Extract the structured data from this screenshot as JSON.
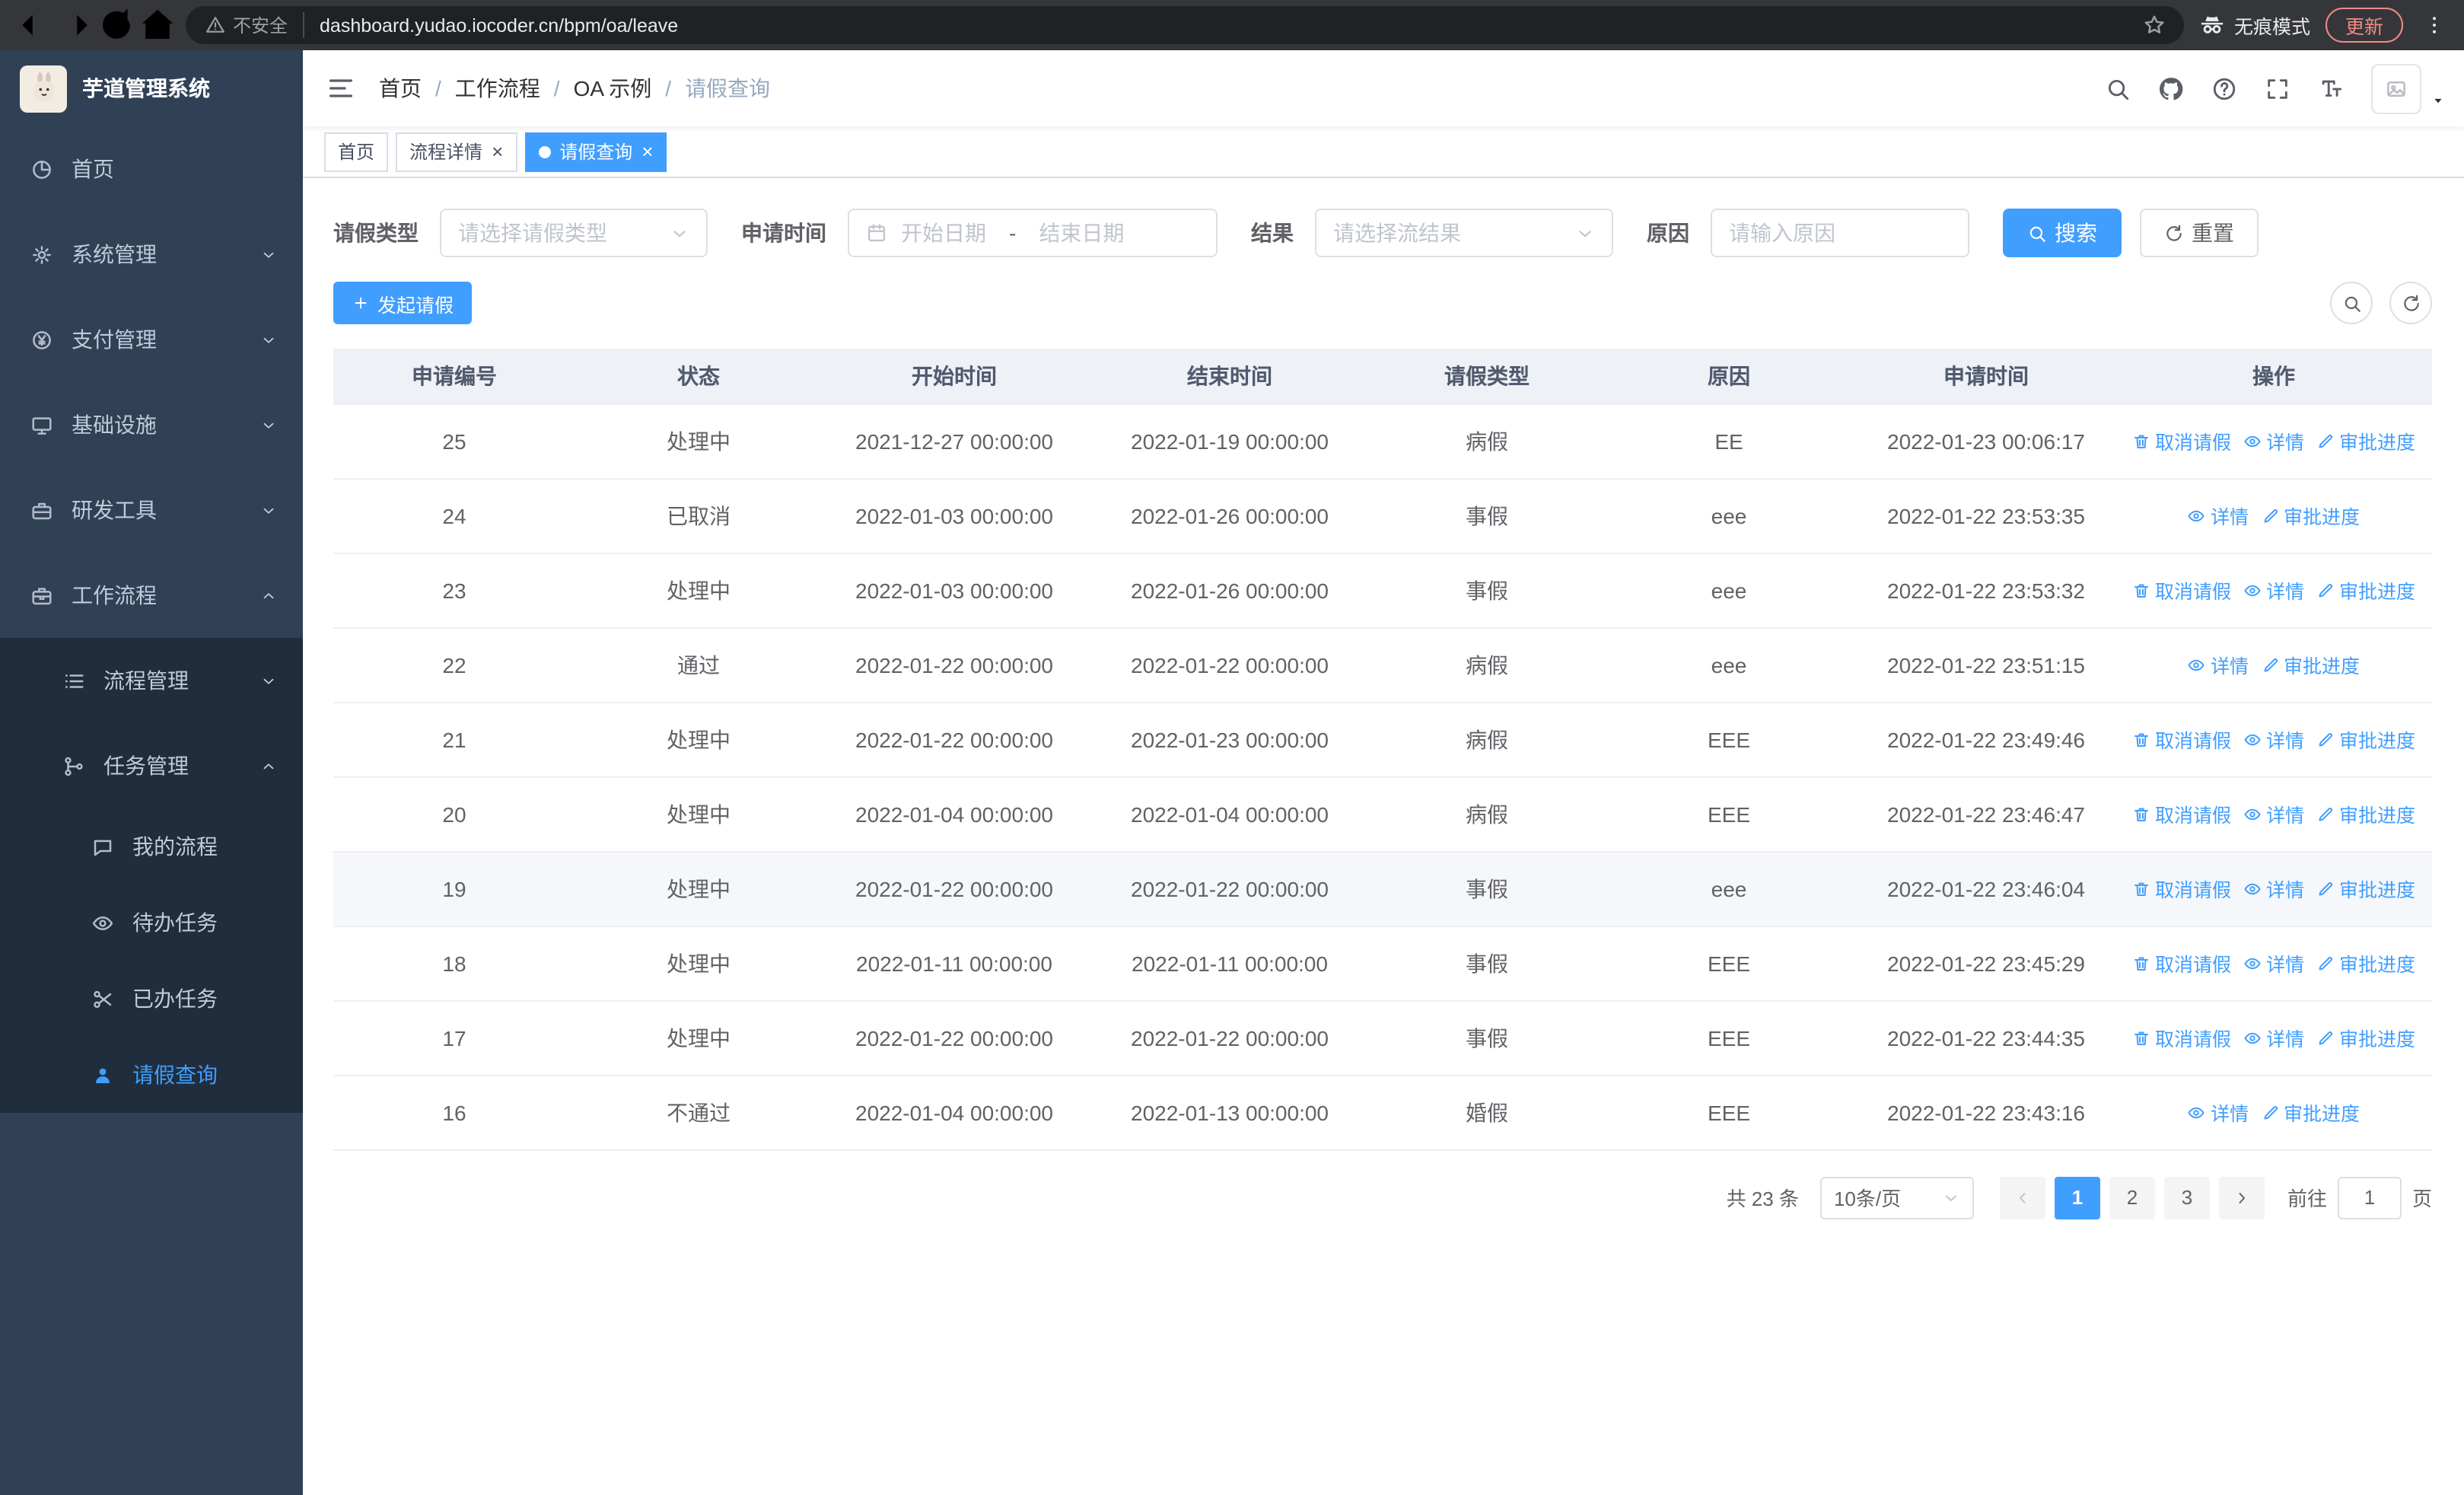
{
  "browser": {
    "security_label": "不安全",
    "url": "dashboard.yudao.iocoder.cn/bpm/oa/leave",
    "incognito_label": "无痕模式",
    "update_label": "更新"
  },
  "sidebar": {
    "logo_title": "芋道管理系统",
    "items": [
      {
        "key": "home",
        "label": "首页",
        "icon": "dashboard-icon",
        "level": 1,
        "arrow": null,
        "active": false
      },
      {
        "key": "system",
        "label": "系统管理",
        "icon": "gear-icon",
        "level": 1,
        "arrow": "down",
        "active": false
      },
      {
        "key": "payment",
        "label": "支付管理",
        "icon": "payment-icon",
        "level": 1,
        "arrow": "down",
        "active": false
      },
      {
        "key": "infrastructure",
        "label": "基础设施",
        "icon": "infrastructure-icon",
        "level": 1,
        "arrow": "down",
        "active": false
      },
      {
        "key": "devtools",
        "label": "研发工具",
        "icon": "tools-icon",
        "level": 1,
        "arrow": "down",
        "active": false
      },
      {
        "key": "workflow",
        "label": "工作流程",
        "icon": "workflow-icon",
        "level": 1,
        "arrow": "up",
        "active": false
      },
      {
        "key": "process-management",
        "label": "流程管理",
        "icon": "process-icon",
        "level": 2,
        "arrow": "down",
        "active": false
      },
      {
        "key": "task-management",
        "label": "任务管理",
        "icon": "task-icon",
        "level": 2,
        "arrow": "up",
        "active": false
      },
      {
        "key": "my-process",
        "label": "我的流程",
        "icon": "my-process-icon",
        "level": 3,
        "arrow": null,
        "active": false
      },
      {
        "key": "todo-task",
        "label": "待办任务",
        "icon": "todo-task-icon",
        "level": 3,
        "arrow": null,
        "active": false
      },
      {
        "key": "done-task",
        "label": "已办任务",
        "icon": "done-task-icon",
        "level": 3,
        "arrow": null,
        "active": false
      },
      {
        "key": "leave-query",
        "label": "请假查询",
        "icon": "leave-query-icon",
        "level": 3,
        "arrow": null,
        "active": true
      }
    ]
  },
  "navbar": {
    "breadcrumb": [
      "首页",
      "工作流程",
      "OA 示例",
      "请假查询"
    ]
  },
  "tabs": [
    {
      "key": "home",
      "label": "首页",
      "closable": false,
      "active": false
    },
    {
      "key": "process-detail",
      "label": "流程详情",
      "closable": true,
      "active": false
    },
    {
      "key": "leave-query",
      "label": "请假查询",
      "closable": true,
      "active": true
    }
  ],
  "filters": {
    "leave_type": {
      "label": "请假类型",
      "placeholder": "请选择请假类型"
    },
    "apply_time": {
      "label": "申请时间",
      "start_placeholder": "开始日期",
      "separator": "-",
      "end_placeholder": "结束日期"
    },
    "result": {
      "label": "结果",
      "placeholder": "请选择流结果"
    },
    "reason": {
      "label": "原因",
      "placeholder": "请输入原因"
    },
    "search_label": "搜索",
    "reset_label": "重置"
  },
  "toolbar": {
    "create_label": "发起请假"
  },
  "table": {
    "columns": [
      "申请编号",
      "状态",
      "开始时间",
      "结束时间",
      "请假类型",
      "原因",
      "申请时间",
      "操作"
    ],
    "action_labels": {
      "cancel": "取消请假",
      "detail": "详情",
      "progress": "审批进度"
    },
    "rows": [
      {
        "id": "25",
        "status": "处理中",
        "start_time": "2021-12-27 00:00:00",
        "end_time": "2022-01-19 00:00:00",
        "leave_type": "病假",
        "reason": "EE",
        "apply_time": "2022-01-23 00:06:17",
        "cancelable": true,
        "highlighted": false
      },
      {
        "id": "24",
        "status": "已取消",
        "start_time": "2022-01-03 00:00:00",
        "end_time": "2022-01-26 00:00:00",
        "leave_type": "事假",
        "reason": "eee",
        "apply_time": "2022-01-22 23:53:35",
        "cancelable": false,
        "highlighted": false
      },
      {
        "id": "23",
        "status": "处理中",
        "start_time": "2022-01-03 00:00:00",
        "end_time": "2022-01-26 00:00:00",
        "leave_type": "事假",
        "reason": "eee",
        "apply_time": "2022-01-22 23:53:32",
        "cancelable": true,
        "highlighted": false
      },
      {
        "id": "22",
        "status": "通过",
        "start_time": "2022-01-22 00:00:00",
        "end_time": "2022-01-22 00:00:00",
        "leave_type": "病假",
        "reason": "eee",
        "apply_time": "2022-01-22 23:51:15",
        "cancelable": false,
        "highlighted": false
      },
      {
        "id": "21",
        "status": "处理中",
        "start_time": "2022-01-22 00:00:00",
        "end_time": "2022-01-23 00:00:00",
        "leave_type": "病假",
        "reason": "EEE",
        "apply_time": "2022-01-22 23:49:46",
        "cancelable": true,
        "highlighted": false
      },
      {
        "id": "20",
        "status": "处理中",
        "start_time": "2022-01-04 00:00:00",
        "end_time": "2022-01-04 00:00:00",
        "leave_type": "病假",
        "reason": "EEE",
        "apply_time": "2022-01-22 23:46:47",
        "cancelable": true,
        "highlighted": false
      },
      {
        "id": "19",
        "status": "处理中",
        "start_time": "2022-01-22 00:00:00",
        "end_time": "2022-01-22 00:00:00",
        "leave_type": "事假",
        "reason": "eee",
        "apply_time": "2022-01-22 23:46:04",
        "cancelable": true,
        "highlighted": true
      },
      {
        "id": "18",
        "status": "处理中",
        "start_time": "2022-01-11 00:00:00",
        "end_time": "2022-01-11 00:00:00",
        "leave_type": "事假",
        "reason": "EEE",
        "apply_time": "2022-01-22 23:45:29",
        "cancelable": true,
        "highlighted": false
      },
      {
        "id": "17",
        "status": "处理中",
        "start_time": "2022-01-22 00:00:00",
        "end_time": "2022-01-22 00:00:00",
        "leave_type": "事假",
        "reason": "EEE",
        "apply_time": "2022-01-22 23:44:35",
        "cancelable": true,
        "highlighted": false
      },
      {
        "id": "16",
        "status": "不通过",
        "start_time": "2022-01-04 00:00:00",
        "end_time": "2022-01-13 00:00:00",
        "leave_type": "婚假",
        "reason": "EEE",
        "apply_time": "2022-01-22 23:43:16",
        "cancelable": false,
        "highlighted": false
      }
    ]
  },
  "pagination": {
    "total_label": "共 23 条",
    "page_size_label": "10条/页",
    "pages": [
      "1",
      "2",
      "3"
    ],
    "active_page": "1",
    "jump_label": "前往",
    "jump_value": "1",
    "jump_suffix": "页"
  },
  "colors": {
    "primary": "#409eff",
    "sidebar_bg": "#304156",
    "submenu_bg": "#1f2d3d",
    "chrome_bg": "#35363a",
    "omnibox_bg": "#202124",
    "update_red": "#f28b82"
  }
}
